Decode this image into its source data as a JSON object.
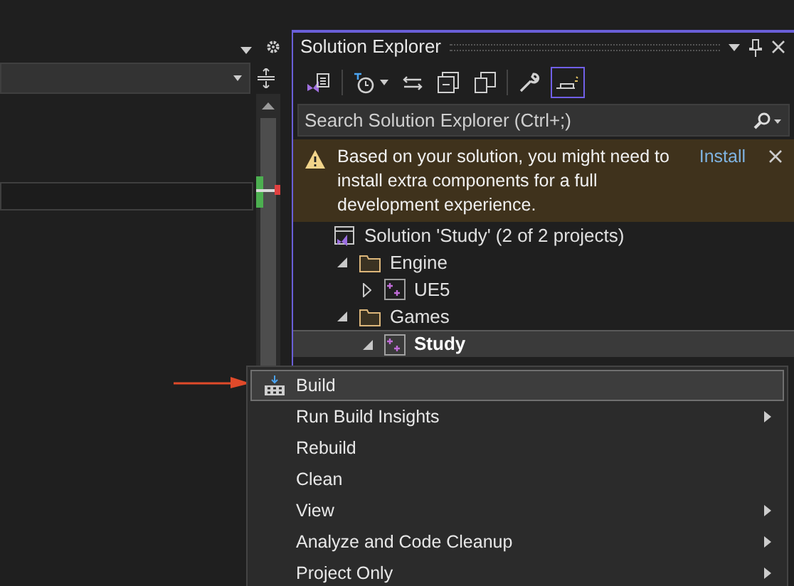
{
  "editor": {
    "options": [
      {
        "kind": "dropdown"
      },
      {
        "kind": "settings"
      }
    ]
  },
  "explorer": {
    "title": "Solution Explorer",
    "toolbar": [
      {
        "kind": "vs-home",
        "selected": false
      },
      {
        "kind": "history",
        "selected": false
      },
      {
        "kind": "sync",
        "selected": false
      },
      {
        "kind": "collapse",
        "selected": false
      },
      {
        "kind": "copies",
        "selected": false
      },
      {
        "kind": "wrench",
        "selected": false
      },
      {
        "kind": "preview",
        "selected": true
      }
    ],
    "search": {
      "placeholder": "Search Solution Explorer (Ctrl+;)"
    },
    "banner": {
      "message": "Based on your solution, you might need to install extra components for a full development experience.",
      "action": "Install"
    },
    "tree": [
      {
        "label": "Solution 'Study' (2 of 2 projects)",
        "kind": "solution",
        "selected": false,
        "children": [
          {
            "label": "Engine",
            "kind": "folder",
            "expanded": true,
            "selected": false,
            "children": [
              {
                "label": "UE5",
                "kind": "project",
                "expanded": false,
                "selected": false
              }
            ]
          },
          {
            "label": "Games",
            "kind": "folder",
            "expanded": true,
            "selected": false,
            "children": [
              {
                "label": "Study",
                "kind": "project",
                "expanded": true,
                "selected": true
              }
            ]
          }
        ]
      }
    ]
  },
  "context_menu": {
    "items": [
      {
        "label": "Build",
        "kind": "build",
        "selected": true,
        "submenu": false
      },
      {
        "label": "Run Build Insights",
        "kind": "command",
        "selected": false,
        "submenu": true
      },
      {
        "label": "Rebuild",
        "kind": "command",
        "selected": false,
        "submenu": false
      },
      {
        "label": "Clean",
        "kind": "command",
        "selected": false,
        "submenu": false
      },
      {
        "label": "View",
        "kind": "command",
        "selected": false,
        "submenu": true
      },
      {
        "label": "Analyze and Code Cleanup",
        "kind": "command",
        "selected": false,
        "submenu": true
      },
      {
        "label": "Project Only",
        "kind": "command",
        "selected": false,
        "submenu": true
      }
    ]
  }
}
